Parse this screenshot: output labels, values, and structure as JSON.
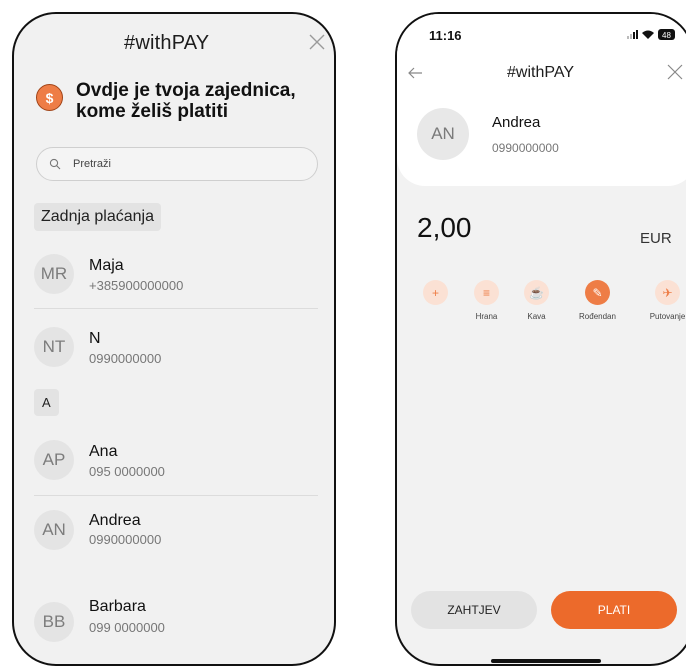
{
  "left": {
    "title": "#withPAY",
    "hero_icon": "$",
    "hero_text": "Ovdje je tvoja zajednica, kome želiš platiti",
    "search_placeholder": "Pretraži",
    "section_recent": "Zadnja plaćanja",
    "recent": [
      {
        "initials": "MR",
        "name": "Maja",
        "phone": "+385900000000"
      },
      {
        "initials": "NT",
        "name": "N",
        "phone": "0990000000"
      }
    ],
    "section_a": "A",
    "contacts_a": [
      {
        "initials": "AP",
        "name": "Ana",
        "phone": "095 0000000"
      },
      {
        "initials": "AN",
        "name": "Andrea",
        "phone": "0990000000"
      }
    ],
    "contacts_b": [
      {
        "initials": "BB",
        "name": "Barbara",
        "phone": "099 0000000"
      }
    ]
  },
  "right": {
    "time": "11:16",
    "battery": "48",
    "title": "#withPAY",
    "recipient": {
      "initials": "AN",
      "name": "Andrea",
      "phone": "0990000000"
    },
    "amount": "2,00",
    "currency": "EUR",
    "categories": [
      {
        "label": "",
        "icon": "+"
      },
      {
        "label": "Hrana",
        "icon": "≡"
      },
      {
        "label": "Kava",
        "icon": "☕"
      },
      {
        "label": "Rođendan",
        "icon": "✎"
      },
      {
        "label": "Putovanje",
        "icon": "✈"
      }
    ],
    "btn_request": "ZAHTJEV",
    "btn_pay": "PLATI"
  },
  "colors": {
    "accent": "#ec6a2b",
    "accent_light": "#fbe1d4"
  }
}
